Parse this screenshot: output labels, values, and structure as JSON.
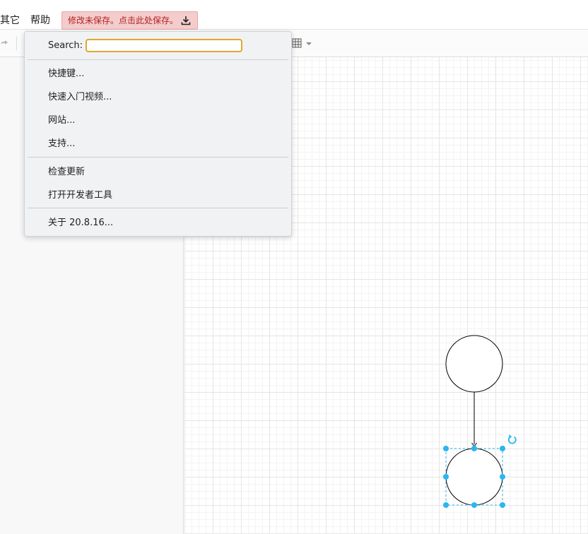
{
  "menubar": {
    "items": [
      {
        "label": "其它"
      },
      {
        "label": "帮助"
      }
    ],
    "unsaved_banner": "修改未保存。点击此处保存。"
  },
  "toolbar": {
    "icons": [
      "redo-icon",
      "table-icon",
      "chevron-down-icon"
    ]
  },
  "help_menu": {
    "search_label": "Search:",
    "search_value": "",
    "groups": [
      {
        "items": [
          "快捷键...",
          "快速入门视频...",
          "网站...",
          "支持..."
        ]
      },
      {
        "items": [
          "检查更新",
          "打开开发者工具"
        ]
      },
      {
        "items": [
          "关于 20.8.16..."
        ]
      }
    ]
  },
  "colors": {
    "selection_handle": "#29b6f2",
    "unsaved_bg": "#f4cccc",
    "unsaved_text": "#b22222",
    "search_focus_border": "#e0a82e"
  }
}
